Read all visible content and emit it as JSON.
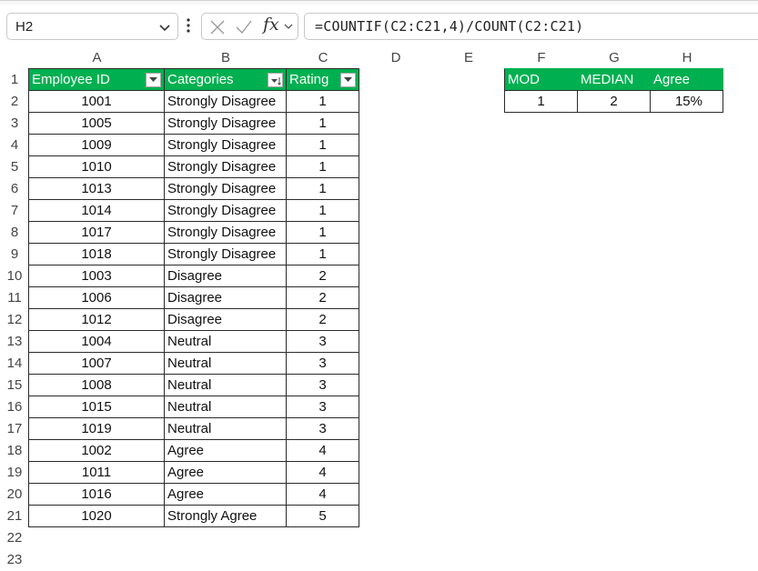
{
  "name_box": "H2",
  "formula": "=COUNTIF(C2:C21,4)/COUNT(C2:C21)",
  "icons": {
    "cancel": "close-icon",
    "enter": "checkmark-icon",
    "function": "fx-icon",
    "more": "more-vert-icon",
    "dropdown": "chevron-down-icon",
    "filter": "filter-arrow-icon",
    "sort": "sort-filter-icon"
  },
  "colors": {
    "header_fill": "#00b050",
    "header_text": "#ffffff"
  },
  "columns": [
    "A",
    "B",
    "C",
    "D",
    "E",
    "F",
    "G",
    "H"
  ],
  "rows": [
    "1",
    "2",
    "3",
    "4",
    "5",
    "6",
    "7",
    "8",
    "9",
    "10",
    "11",
    "12",
    "13",
    "14",
    "15",
    "16",
    "17",
    "18",
    "19",
    "20",
    "21",
    "22",
    "23"
  ],
  "table": {
    "headers": [
      "Employee ID",
      "Categories",
      "Rating"
    ],
    "rows": [
      [
        "1001",
        "Strongly Disagree",
        "1"
      ],
      [
        "1005",
        "Strongly Disagree",
        "1"
      ],
      [
        "1009",
        "Strongly Disagree",
        "1"
      ],
      [
        "1010",
        "Strongly Disagree",
        "1"
      ],
      [
        "1013",
        "Strongly Disagree",
        "1"
      ],
      [
        "1014",
        "Strongly Disagree",
        "1"
      ],
      [
        "1017",
        "Strongly Disagree",
        "1"
      ],
      [
        "1018",
        "Strongly Disagree",
        "1"
      ],
      [
        "1003",
        "Disagree",
        "2"
      ],
      [
        "1006",
        "Disagree",
        "2"
      ],
      [
        "1012",
        "Disagree",
        "2"
      ],
      [
        "1004",
        "Neutral",
        "3"
      ],
      [
        "1007",
        "Neutral",
        "3"
      ],
      [
        "1008",
        "Neutral",
        "3"
      ],
      [
        "1015",
        "Neutral",
        "3"
      ],
      [
        "1019",
        "Neutral",
        "3"
      ],
      [
        "1002",
        "Agree",
        "4"
      ],
      [
        "1011",
        "Agree",
        "4"
      ],
      [
        "1016",
        "Agree",
        "4"
      ],
      [
        "1020",
        "Strongly Agree",
        "5"
      ]
    ]
  },
  "summary": {
    "headers": [
      "MOD",
      "MEDIAN",
      "Agree"
    ],
    "values": [
      "1",
      "2",
      "15%"
    ]
  }
}
